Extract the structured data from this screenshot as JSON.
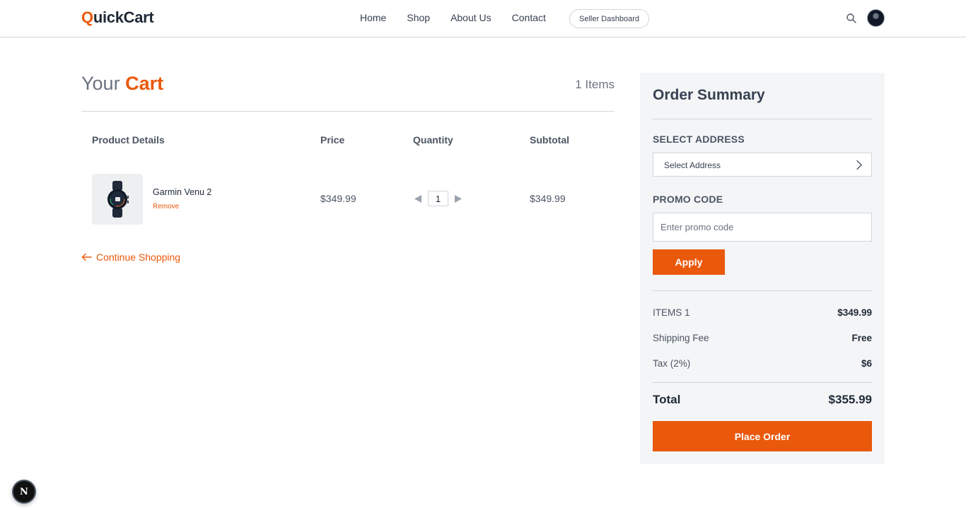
{
  "brand": {
    "logo_first": "Q",
    "logo_rest": "uickCart",
    "accent_color": "#ea580c"
  },
  "nav": {
    "links": [
      "Home",
      "Shop",
      "About Us",
      "Contact"
    ],
    "seller_button": "Seller Dashboard",
    "search_icon": "search-icon",
    "avatar": "user-avatar"
  },
  "cart": {
    "title_prefix": "Your",
    "title_accent": "Cart",
    "item_count": "1 Items",
    "columns": [
      "Product Details",
      "Price",
      "Quantity",
      "Subtotal"
    ],
    "items": [
      {
        "name": "Garmin Venu 2",
        "remove_label": "Remove",
        "price": "$349.99",
        "quantity": "1",
        "subtotal": "$349.99"
      }
    ],
    "continue_label": "Continue Shopping"
  },
  "summary": {
    "title": "Order Summary",
    "address_label": "SELECT ADDRESS",
    "address_value": "Select Address",
    "promo_label": "PROMO CODE",
    "promo_placeholder": "Enter promo code",
    "apply_label": "Apply",
    "rows": [
      {
        "label": "ITEMS 1",
        "value": "$349.99"
      },
      {
        "label": "Shipping Fee",
        "value": "Free"
      },
      {
        "label": "Tax (2%)",
        "value": "$6"
      }
    ],
    "total_label": "Total",
    "total_value": "$355.99",
    "place_order_label": "Place Order"
  },
  "dev_badge": "N"
}
